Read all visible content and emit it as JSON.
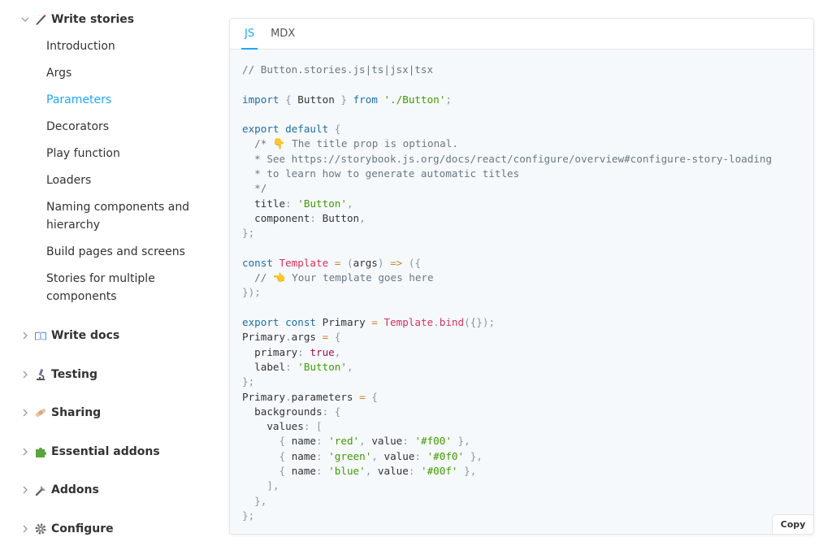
{
  "sidebar": {
    "sections": [
      {
        "label": "Write stories",
        "icon": "pencil-icon",
        "expanded": true
      },
      {
        "label": "Write docs",
        "icon": "book-icon",
        "expanded": false
      },
      {
        "label": "Testing",
        "icon": "microscope-icon",
        "expanded": false
      },
      {
        "label": "Sharing",
        "icon": "bandage-icon",
        "expanded": false
      },
      {
        "label": "Essential addons",
        "icon": "puzzle-icon",
        "expanded": false
      },
      {
        "label": "Addons",
        "icon": "wrench-icon",
        "expanded": false
      },
      {
        "label": "Configure",
        "icon": "gear-icon",
        "expanded": false
      }
    ],
    "items": [
      {
        "label": "Introduction",
        "active": false
      },
      {
        "label": "Args",
        "active": false
      },
      {
        "label": "Parameters",
        "active": true
      },
      {
        "label": "Decorators",
        "active": false
      },
      {
        "label": "Play function",
        "active": false
      },
      {
        "label": "Loaders",
        "active": false
      },
      {
        "label": "Naming components and hierarchy",
        "active": false
      },
      {
        "label": "Build pages and screens",
        "active": false
      },
      {
        "label": "Stories for multiple components",
        "active": false
      }
    ]
  },
  "code_panel": {
    "tabs": [
      {
        "label": "JS",
        "active": true
      },
      {
        "label": "MDX",
        "active": false
      }
    ],
    "copy_label": "Copy",
    "code_lines": [
      "// Button.stories.js|ts|jsx|tsx",
      "",
      "import { Button } from './Button';",
      "",
      "export default {",
      "  /* 👇 The title prop is optional.",
      "  * See https://storybook.js.org/docs/react/configure/overview#configure-story-loading",
      "  * to learn how to generate automatic titles",
      "  */",
      "  title: 'Button',",
      "  component: Button,",
      "};",
      "",
      "const Template = (args) => ({",
      "  // 👈 Your template goes here",
      "});",
      "",
      "export const Primary = Template.bind({});",
      "Primary.args = {",
      "  primary: true,",
      "  label: 'Button',",
      "};",
      "Primary.parameters = {",
      "  backgrounds: {",
      "    values: [",
      "      { name: 'red', value: '#f00' },",
      "      { name: 'green', value: '#0f0' },",
      "      { name: 'blue', value: '#00f' },",
      "    ],",
      "  },",
      "};"
    ]
  },
  "colors": {
    "accent": "#1ea7fd",
    "code_bg": "#f6f9fc",
    "keyword": "#1c6ea6",
    "string": "#3f9a00",
    "function": "#d8305c",
    "comment": "#6b7785"
  }
}
